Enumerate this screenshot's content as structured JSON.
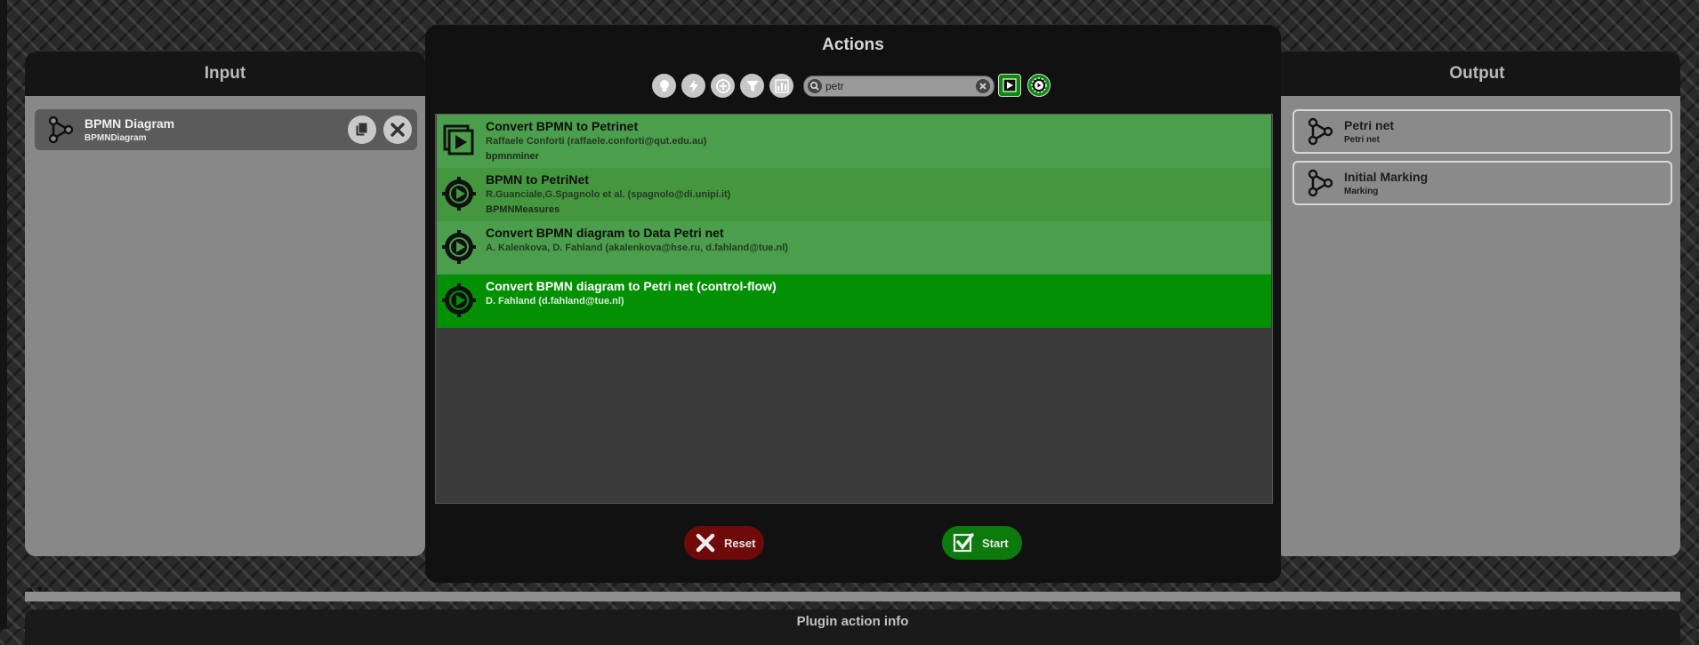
{
  "input": {
    "title": "Input",
    "items": [
      {
        "title": "BPMN Diagram",
        "subtitle": "BPMNDiagram"
      }
    ]
  },
  "output": {
    "title": "Output",
    "items": [
      {
        "title": "Petri net",
        "subtitle": "Petri net"
      },
      {
        "title": "Initial Marking",
        "subtitle": "Marking"
      }
    ]
  },
  "actions": {
    "title": "Actions",
    "search_value": "petr",
    "rows": [
      {
        "title": "Convert BPMN to Petrinet",
        "author": "Raffaele Conforti (raffaele.conforti@qut.edu.au)",
        "package": "bpmnminer",
        "icon": "play-box-icon"
      },
      {
        "title": "BPMN to PetriNet",
        "author": "R.Guanciale,G.Spagnolo et al. (spagnolo@di.unipi.it)",
        "package": "BPMNMeasures",
        "icon": "gear-play-icon"
      },
      {
        "title": "Convert BPMN diagram to Data Petri net",
        "author": "A. Kalenkova, D. Fahland (akalenkova@hse.ru, d.fahland@tue.nl)",
        "package": "",
        "icon": "gear-play-icon"
      },
      {
        "title": "Convert BPMN diagram to Petri net (control-flow)",
        "author": "D. Fahland (d.fahland@tue.nl)",
        "package": "",
        "icon": "gear-play-icon",
        "selected": true
      }
    ],
    "reset_label": "Reset",
    "start_label": "Start"
  },
  "bottom": {
    "title": "Plugin action info"
  },
  "colors": {
    "row_even": "#4b9e4b",
    "row_odd": "#45973f",
    "row_selected": "#049004",
    "reset": "#700a0a",
    "start": "#0d7a0d"
  }
}
